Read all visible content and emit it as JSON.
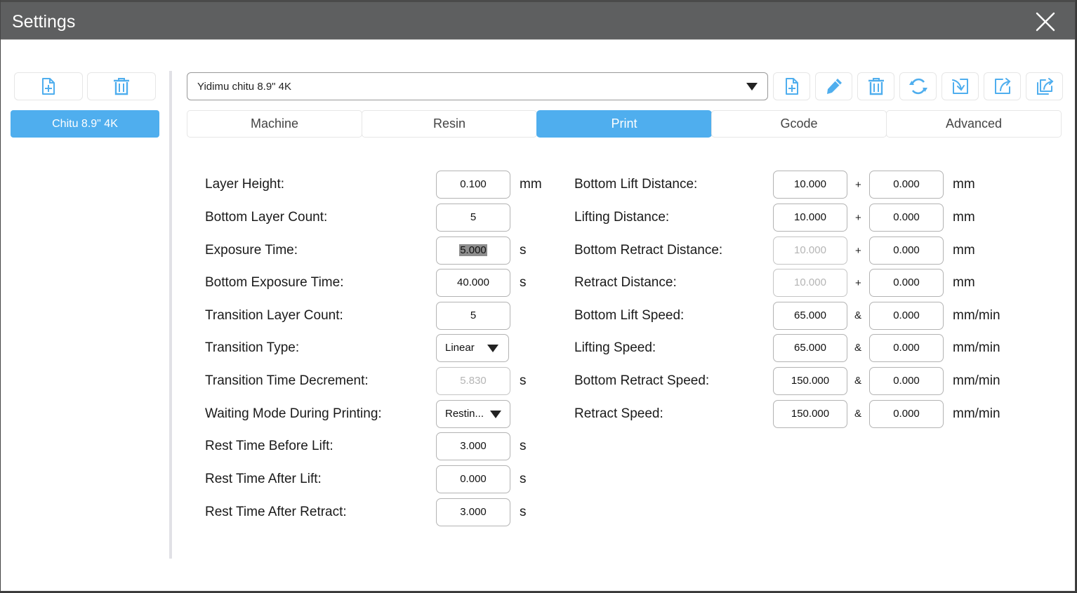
{
  "window": {
    "title": "Settings"
  },
  "sidebar": {
    "add_icon": "file-plus-icon",
    "delete_icon": "trash-icon",
    "profiles": [
      {
        "label": "Chitu 8.9\" 4K",
        "selected": true
      }
    ]
  },
  "profile_select": {
    "value": "Yidimu chitu 8.9\" 4K"
  },
  "toolbar": [
    {
      "icon": "file-plus-icon",
      "name": "new-profile-button"
    },
    {
      "icon": "pencil-icon",
      "name": "rename-profile-button"
    },
    {
      "icon": "trash-icon",
      "name": "delete-profile-button"
    },
    {
      "icon": "refresh-icon",
      "name": "reset-profile-button"
    },
    {
      "icon": "import-icon",
      "name": "import-profile-button"
    },
    {
      "icon": "export-icon",
      "name": "export-profile-button"
    },
    {
      "icon": "export-all-icon",
      "name": "export-all-button"
    }
  ],
  "tabs": [
    {
      "label": "Machine",
      "active": false
    },
    {
      "label": "Resin",
      "active": false
    },
    {
      "label": "Print",
      "active": true
    },
    {
      "label": "Gcode",
      "active": false
    },
    {
      "label": "Advanced",
      "active": false
    }
  ],
  "accent_color": "#4faeee",
  "left_fields": [
    {
      "label": "Layer Height:",
      "value": "0.100",
      "unit": "mm",
      "type": "input"
    },
    {
      "label": "Bottom Layer Count:",
      "value": "5",
      "unit": "",
      "type": "input"
    },
    {
      "label": "Exposure Time:",
      "value": "5.000",
      "unit": "s",
      "type": "input",
      "selected_text": true
    },
    {
      "label": "Bottom Exposure Time:",
      "value": "40.000",
      "unit": "s",
      "type": "input"
    },
    {
      "label": "Transition Layer Count:",
      "value": "5",
      "unit": "",
      "type": "input"
    },
    {
      "label": "Transition Type:",
      "value": "Linear",
      "unit": "",
      "type": "select"
    },
    {
      "label": "Transition Time Decrement:",
      "value": "5.830",
      "unit": "s",
      "type": "input",
      "disabled": true
    },
    {
      "label": "Waiting Mode During Printing:",
      "value": "Restin...",
      "unit": "",
      "type": "select"
    },
    {
      "label": "Rest Time Before Lift:",
      "value": "3.000",
      "unit": "s",
      "type": "input"
    },
    {
      "label": "Rest Time After Lift:",
      "value": "0.000",
      "unit": "s",
      "type": "input"
    },
    {
      "label": "Rest Time After Retract:",
      "value": "3.000",
      "unit": "s",
      "type": "input"
    }
  ],
  "right_fields": [
    {
      "label": "Bottom Lift Distance:",
      "value1": "10.000",
      "op": "+",
      "value2": "0.000",
      "unit": "mm"
    },
    {
      "label": "Lifting Distance:",
      "value1": "10.000",
      "op": "+",
      "value2": "0.000",
      "unit": "mm"
    },
    {
      "label": "Bottom Retract Distance:",
      "value1": "10.000",
      "op": "+",
      "value2": "0.000",
      "unit": "mm",
      "disabled1": true
    },
    {
      "label": "Retract Distance:",
      "value1": "10.000",
      "op": "+",
      "value2": "0.000",
      "unit": "mm",
      "disabled1": true
    },
    {
      "label": "Bottom Lift Speed:",
      "value1": "65.000",
      "op": "&",
      "value2": "0.000",
      "unit": "mm/min"
    },
    {
      "label": "Lifting Speed:",
      "value1": "65.000",
      "op": "&",
      "value2": "0.000",
      "unit": "mm/min"
    },
    {
      "label": "Bottom Retract Speed:",
      "value1": "150.000",
      "op": "&",
      "value2": "0.000",
      "unit": "mm/min"
    },
    {
      "label": "Retract Speed:",
      "value1": "150.000",
      "op": "&",
      "value2": "0.000",
      "unit": "mm/min"
    }
  ]
}
